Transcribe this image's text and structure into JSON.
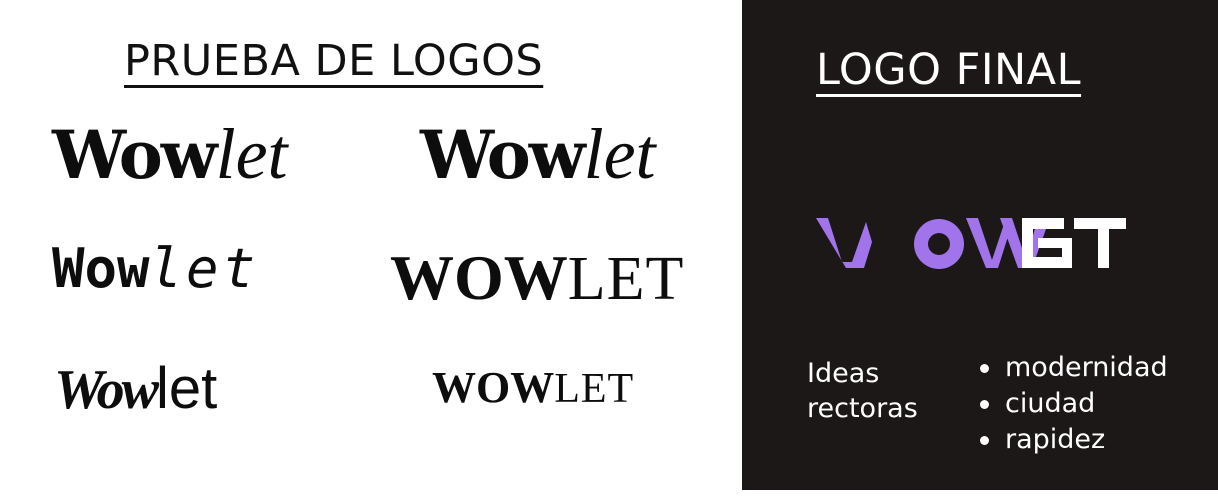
{
  "left_panel": {
    "heading": "PRUEBA DE LOGOS",
    "logos": [
      {
        "part1": "Wow",
        "part2": "let"
      },
      {
        "part1": "Wow",
        "part2": "let"
      },
      {
        "part1": "Wow",
        "part2": "let"
      },
      {
        "part1": "WOW",
        "part2": "LET"
      },
      {
        "part1": "Wow",
        "part2": "let"
      },
      {
        "part1": "WOW",
        "part2": "LET"
      }
    ]
  },
  "right_panel": {
    "heading": "LOGO FINAL",
    "final_logo": {
      "text": "WOWLET",
      "colors": {
        "wow": "#a274ec",
        "let": "#ffffff"
      }
    },
    "ideas_label": [
      "Ideas",
      "rectoras"
    ],
    "ideas": [
      "modernidad",
      "ciudad",
      "rapidez"
    ],
    "background": "#1c1818"
  }
}
